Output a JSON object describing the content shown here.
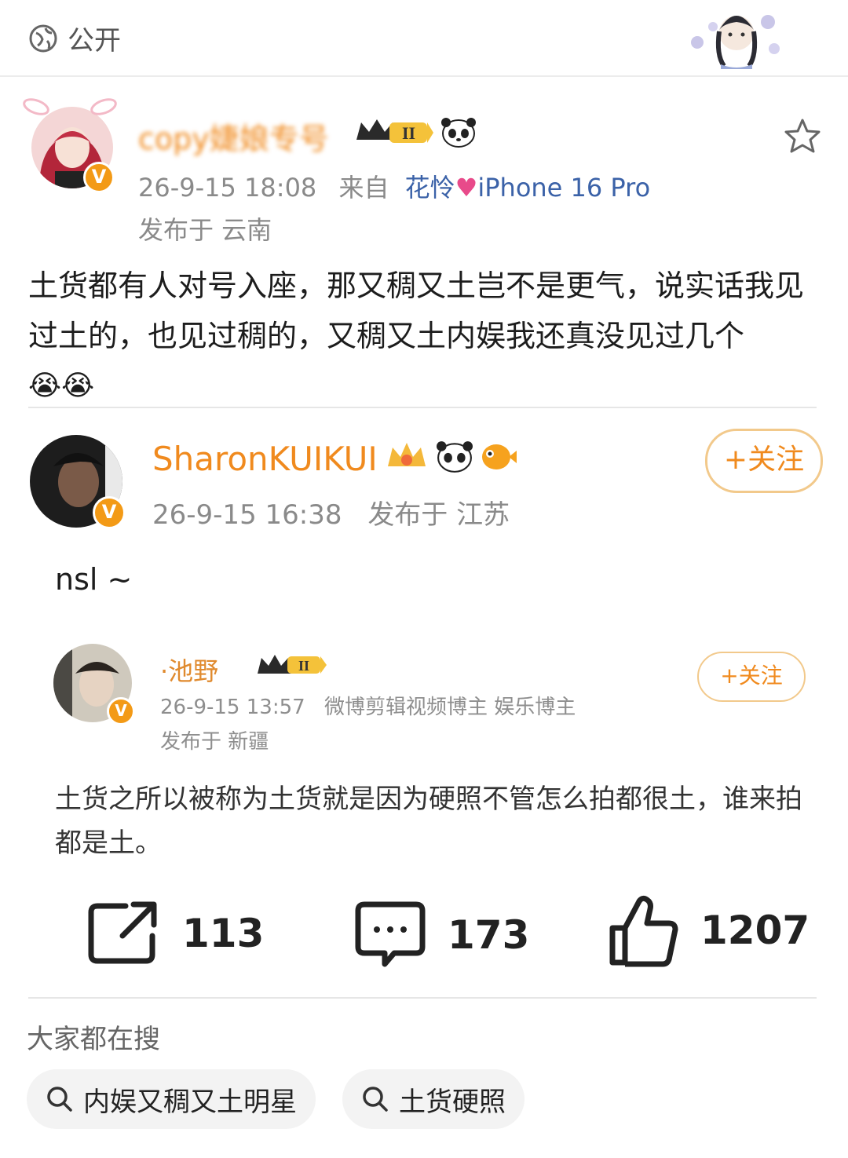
{
  "top": {
    "visibility_label": "公开"
  },
  "main_post": {
    "username": "copy婕娘专号",
    "level": "II",
    "timestamp": "26-9-15 18:08",
    "source_prefix": "来自",
    "source_name": "花怜",
    "device": "iPhone 16 Pro",
    "location": "发布于 云南",
    "content": "土货都有人对号入座，那又稠又土岂不是更气，说实话我见过土的，也见过稠的，又稠又土内娱我还真没见过几个",
    "emoji": "😭😭"
  },
  "repost": {
    "username": "SharonKUIKUI",
    "timestamp": "26-9-15 16:38",
    "location": "发布于 江苏",
    "follow_label": "+关注",
    "content": "nsl ~"
  },
  "quoted": {
    "username": "·池野",
    "level": "II",
    "timestamp": "26-9-15 13:57",
    "tags": "微博剪辑视频博主 娱乐博主",
    "location": "发布于 新疆",
    "follow_label": "+关注",
    "content": "土货之所以被称为土货就是因为硬照不管怎么拍都很土，谁来拍都是土。"
  },
  "stats": {
    "reposts": "113",
    "comments": "173",
    "likes": "1207"
  },
  "search": {
    "title": "大家都在搜",
    "items": [
      "内娱又稠又土明星",
      "土货硬照"
    ]
  },
  "colors": {
    "accent": "#f08a1e",
    "badge": "#f39a16"
  }
}
